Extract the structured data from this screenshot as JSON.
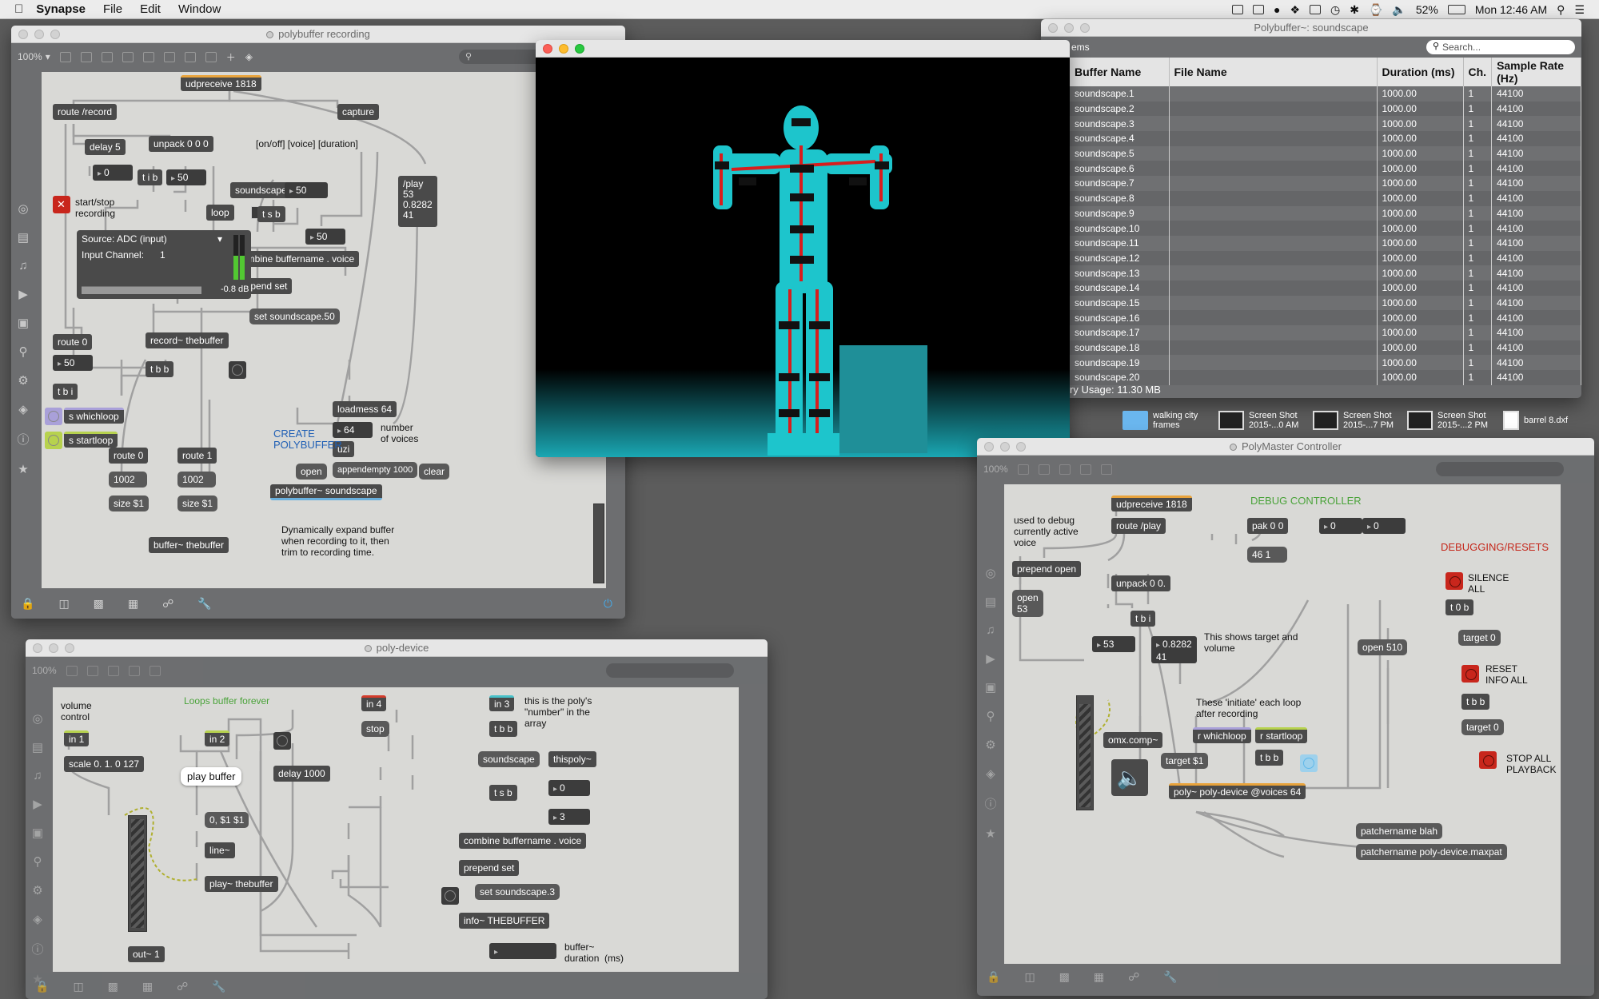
{
  "menubar": {
    "app_name": "Synapse",
    "menus": [
      "File",
      "Edit",
      "Window"
    ],
    "battery": "52%",
    "clock": "Mon 12:46 AM"
  },
  "recording_window": {
    "title": "polybuffer recording",
    "zoom": "100%",
    "objects": {
      "udpreceive": "udpreceive 1818",
      "route_record": "route /record",
      "capture": "capture",
      "delay": "delay 5",
      "unpack": "unpack 0 0 0",
      "unpack_comment": "[on/off] [voice] [duration]",
      "num0": "0",
      "tib": "t i b",
      "num50a": "50",
      "loop": "loop",
      "soundscape": "soundscape",
      "num50b": "50",
      "tsb": "t s b",
      "num50c": "50",
      "combine": "combine buffername . voice",
      "prepend": "prepend set",
      "setmsg": "set soundscape.50",
      "play_msg": "/play\n53\n0.8282\n41",
      "startstop": "start/stop\nrecording",
      "adc_source": "Source: ADC (input)",
      "adc_channel_label": "Input Channel:",
      "adc_channel": "1",
      "adc_db": "-0.8 dB",
      "route0": "route 0",
      "num50d": "50",
      "record": "record~ thebuffer",
      "tbb": "t b b",
      "tbi": "t b i",
      "swhichloop": "s whichloop",
      "sstartloop": "s startloop",
      "route0b": "route 0",
      "route1": "route 1",
      "n1002a": "1002",
      "n1002b": "1002",
      "size1": "size $1",
      "size2": "size $1",
      "buffer": "buffer~ thebuffer",
      "dyn_comment": "Dynamically expand buffer\nwhen recording to it, then\ntrim to recording time.",
      "loadmess": "loadmess 64",
      "num64": "64",
      "voices_comment": "number\nof voices",
      "uzi": "uzi",
      "appendempty": "appendempty 1000",
      "open": "open",
      "clear": "clear",
      "create_comment": "CREATE\nPOLYBUFFER",
      "polybuffer": "polybuffer~ soundscape"
    }
  },
  "polybuffer_window": {
    "title": "Polybuffer~: soundscape",
    "search_placeholder": "Search...",
    "items_label": "ems",
    "columns": [
      "Buffer Name",
      "File Name",
      "Duration (ms)",
      "Ch.",
      "Sample Rate (Hz)"
    ],
    "rows": [
      [
        "soundscape.1",
        "",
        "1000.00",
        "1",
        "44100"
      ],
      [
        "soundscape.2",
        "",
        "1000.00",
        "1",
        "44100"
      ],
      [
        "soundscape.3",
        "",
        "1000.00",
        "1",
        "44100"
      ],
      [
        "soundscape.4",
        "",
        "1000.00",
        "1",
        "44100"
      ],
      [
        "soundscape.5",
        "",
        "1000.00",
        "1",
        "44100"
      ],
      [
        "soundscape.6",
        "",
        "1000.00",
        "1",
        "44100"
      ],
      [
        "soundscape.7",
        "",
        "1000.00",
        "1",
        "44100"
      ],
      [
        "soundscape.8",
        "",
        "1000.00",
        "1",
        "44100"
      ],
      [
        "soundscape.9",
        "",
        "1000.00",
        "1",
        "44100"
      ],
      [
        "soundscape.10",
        "",
        "1000.00",
        "1",
        "44100"
      ],
      [
        "soundscape.11",
        "",
        "1000.00",
        "1",
        "44100"
      ],
      [
        "soundscape.12",
        "",
        "1000.00",
        "1",
        "44100"
      ],
      [
        "soundscape.13",
        "",
        "1000.00",
        "1",
        "44100"
      ],
      [
        "soundscape.14",
        "",
        "1000.00",
        "1",
        "44100"
      ],
      [
        "soundscape.15",
        "",
        "1000.00",
        "1",
        "44100"
      ],
      [
        "soundscape.16",
        "",
        "1000.00",
        "1",
        "44100"
      ],
      [
        "soundscape.17",
        "",
        "1000.00",
        "1",
        "44100"
      ],
      [
        "soundscape.18",
        "",
        "1000.00",
        "1",
        "44100"
      ],
      [
        "soundscape.19",
        "",
        "1000.00",
        "1",
        "44100"
      ],
      [
        "soundscape.20",
        "",
        "1000.00",
        "1",
        "44100"
      ]
    ],
    "memory_usage": "ry Usage: 11.30 MB"
  },
  "desktop": {
    "items": [
      {
        "label": "walking city\nframes",
        "icon": "folder-icon"
      },
      {
        "label": "Screen Shot\n2015-...0 AM",
        "icon": "image-file-icon"
      },
      {
        "label": "Screen Shot\n2015-...7 PM",
        "icon": "image-file-icon"
      },
      {
        "label": "Screen Shot\n2015-...2 PM",
        "icon": "image-file-icon"
      },
      {
        "label": "barrel 8.dxf",
        "icon": "dxf-file-icon"
      }
    ]
  },
  "controller_window": {
    "title": "PolyMaster Controller",
    "zoom": "100%",
    "objects": {
      "debug_comment": "used to debug\ncurrently active\nvoice",
      "udpreceive": "udpreceive 1818",
      "route_play": "route /play",
      "debug_title": "DEBUG CONTROLLER",
      "pak": "pak 0 0",
      "n0a": "0",
      "n0b": "0",
      "n461": "46 1",
      "prepend_open": "prepend open",
      "unpack": "unpack 0 0.",
      "open53": "open\n53",
      "tbi": "t b i",
      "n53": "53",
      "n08282": "0.8282\n41",
      "shows_comment": "This shows target and\nvolume",
      "open510": "open 510",
      "resets_title": "DEBUGGING/RESETS",
      "silence": "SILENCE\nALL",
      "t0b": "t 0 b",
      "target0a": "target 0",
      "reset": "RESET\nINFO ALL",
      "tbb": "t b b",
      "target0b": "target 0",
      "stop_all": "STOP ALL\nPLAYBACK",
      "initiate_comment": "These 'initiate' each loop\nafter recording",
      "omx": "omx.comp~",
      "rwhichloop": "r whichloop",
      "rstartloop": "r startloop",
      "target1": "target $1",
      "tbb2": "t b b",
      "poly": "poly~ poly-device @voices 64",
      "pn_blah": "patchername blah",
      "pn_device": "patchername poly-device.maxpat"
    }
  },
  "device_window": {
    "title": "poly-device",
    "zoom": "100%",
    "objects": {
      "volume_comment": "volume\ncontrol",
      "loops_comment": "Loops buffer forever",
      "in1": "in 1",
      "in2": "in 2",
      "in4": "in 4",
      "in3": "in 3",
      "number_comment": "this is the poly's\n\"number\" in the\narray",
      "scale": "scale 0. 1. 0 127",
      "stop": "stop",
      "tbb": "t b b",
      "delay": "delay 1000",
      "soundscape": "soundscape",
      "thispoly": "thispoly~",
      "play_buffer": "play buffer",
      "n0": "0",
      "tsb": "t s b",
      "n3": "3",
      "msg": "0, $1 $1",
      "line": "line~",
      "combine": "combine buffername . voice",
      "prepend": "prepend set",
      "play": "play~ thebuffer",
      "setmsg": "set soundscape.3",
      "info": "info~ THEBUFFER",
      "out1": "out~ 1",
      "duration_comment": "buffer~\nduration  (ms)"
    }
  }
}
